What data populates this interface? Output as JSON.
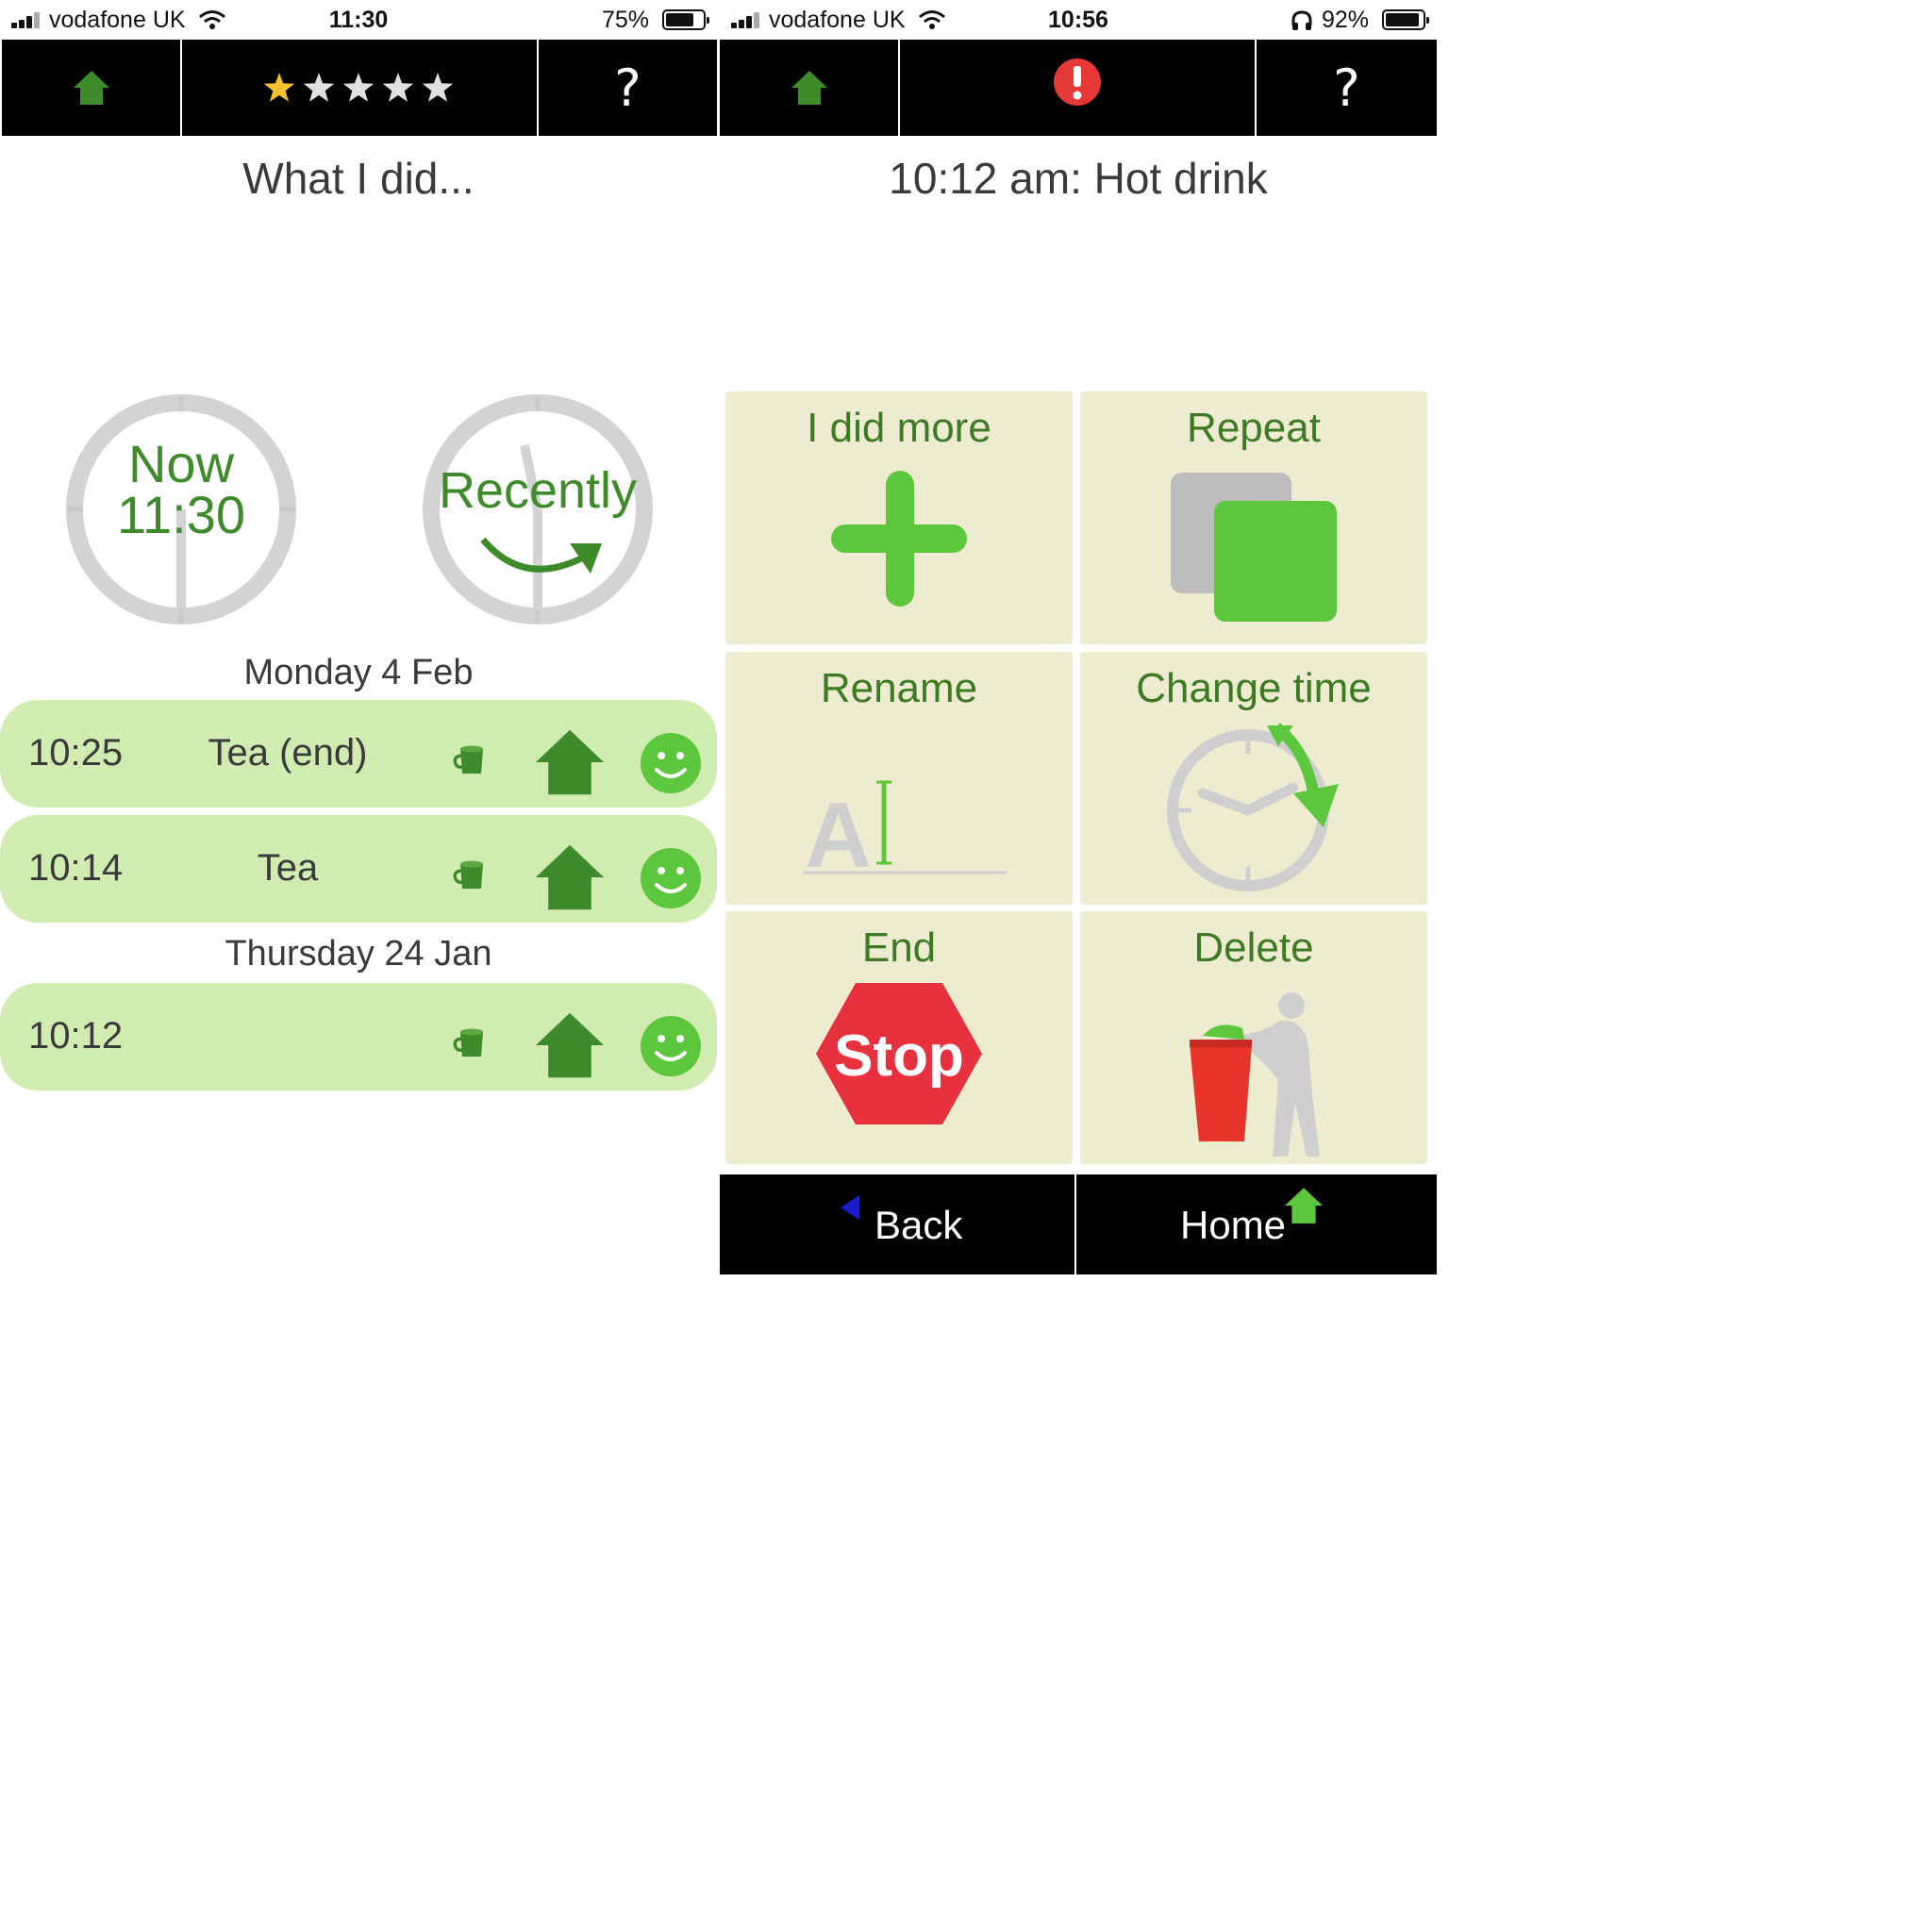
{
  "left_screen": {
    "status": {
      "carrier": "vodafone UK",
      "time": "11:30",
      "battery": "75%",
      "battery_level": 0.75
    },
    "topbar": {
      "rating": {
        "filled_stars": 1,
        "total_stars": 5
      },
      "help_label": "?"
    },
    "title": "What I did...",
    "buttons": {
      "now_label": "Now",
      "now_time": "11:30",
      "recently_label": "Recently"
    },
    "days": [
      {
        "label": "Monday 4 Feb",
        "entries": [
          {
            "time": "10:25",
            "name": "Tea (end)"
          },
          {
            "time": "10:14",
            "name": "Tea"
          }
        ]
      },
      {
        "label": "Thursday 24 Jan",
        "entries": [
          {
            "time": "10:12",
            "name": ""
          }
        ]
      }
    ]
  },
  "right_screen": {
    "status": {
      "carrier": "vodafone UK",
      "time": "10:56",
      "battery": "92%",
      "battery_level": 0.92
    },
    "topbar": {
      "help_label": "?"
    },
    "title": "10:12 am: Hot drink",
    "tiles": {
      "more": "I did more",
      "repeat": "Repeat",
      "rename": "Rename",
      "change_time": "Change time",
      "end": "End",
      "stop_sign": "Stop",
      "delete": "Delete"
    },
    "bottom": {
      "back": "Back",
      "home": "Home"
    }
  },
  "colors": {
    "green_dark": "#3d8b2b",
    "green_bright": "#5cc63c",
    "row_bg": "#d1ecb1",
    "tile_bg": "#eeecd0",
    "stop_red": "#e8313f",
    "alert_red": "#e53935",
    "star_gold": "#f2c12e"
  }
}
